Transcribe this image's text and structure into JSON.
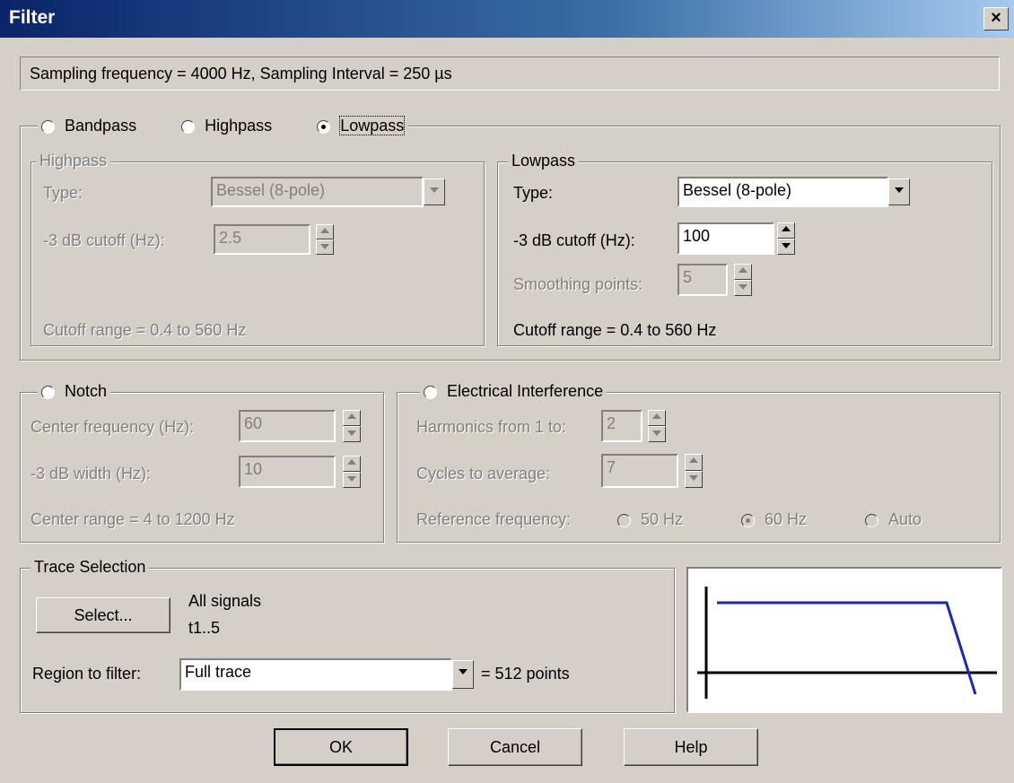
{
  "window": {
    "title": "Filter",
    "close_label": "×"
  },
  "info": {
    "text": "Sampling frequency = 4000 Hz, Sampling Interval = 250 µs"
  },
  "filter_type": {
    "bandpass_label": "Bandpass",
    "highpass_label": "Highpass",
    "lowpass_label": "Lowpass",
    "selected": "Lowpass"
  },
  "highpass": {
    "legend": "Highpass",
    "type_label": "Type:",
    "type_value": "Bessel (8-pole)",
    "cutoff_label": "-3 dB cutoff (Hz):",
    "cutoff_value": "2.5",
    "range_text": "Cutoff range = 0.4 to 560 Hz"
  },
  "lowpass": {
    "legend": "Lowpass",
    "type_label": "Type:",
    "type_value": "Bessel (8-pole)",
    "cutoff_label": "-3 dB cutoff (Hz):",
    "cutoff_value": "100",
    "smoothing_label": "Smoothing points:",
    "smoothing_value": "5",
    "range_text": "Cutoff range = 0.4 to 560 Hz"
  },
  "notch": {
    "label": "Notch",
    "center_label": "Center frequency (Hz):",
    "center_value": "60",
    "width_label": "-3 dB width (Hz):",
    "width_value": "10",
    "range_text": "Center range = 4 to 1200 Hz"
  },
  "electrical": {
    "label": "Electrical Interference",
    "harmonics_label": "Harmonics from 1 to:",
    "harmonics_value": "2",
    "cycles_label": "Cycles to average:",
    "cycles_value": "7",
    "reference_label": "Reference frequency:",
    "ref_50": "50 Hz",
    "ref_60": "60 Hz",
    "ref_auto": "Auto",
    "ref_selected": "60 Hz"
  },
  "trace": {
    "legend": "Trace Selection",
    "select_button": "Select...",
    "signals_text": "All signals",
    "traces_text": "t1..5",
    "region_label": "Region to filter:",
    "region_value": "Full trace",
    "points_text": "= 512 points"
  },
  "buttons": {
    "ok": "OK",
    "cancel": "Cancel",
    "help": "Help"
  },
  "colors": {
    "titlebar_start": "#0a246a",
    "titlebar_end": "#a6caf0",
    "dialog_bg": "#d4d0c8",
    "response_curve": "#1a2ab0"
  },
  "icons": {
    "close": "close-icon",
    "dropdown": "chevron-down-icon",
    "spin": "spin-arrows-icon"
  }
}
